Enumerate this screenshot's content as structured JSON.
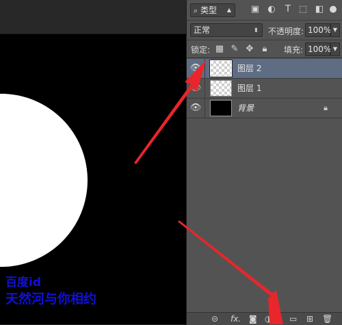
{
  "layers_panel": {
    "filter": {
      "kind_label": "类型"
    },
    "blend": {
      "mode": "正常",
      "opacity_label": "不透明度:",
      "opacity_value": "100%"
    },
    "lock": {
      "lock_label": "锁定:",
      "fill_label": "填充:",
      "fill_value": "100%"
    },
    "layers": [
      {
        "name": "图层 2",
        "selected": true
      },
      {
        "name": "图层 1",
        "selected": false
      },
      {
        "name": "背景",
        "selected": false
      }
    ],
    "bottom": {
      "fx_label": "fx."
    }
  },
  "watermark": {
    "line1": "百度id",
    "line2": "天然河与你相约"
  },
  "colors": {
    "accent_selected": "#5e6d83",
    "annotation_arrow": "#e8262b",
    "watermark": "#1010d8"
  }
}
